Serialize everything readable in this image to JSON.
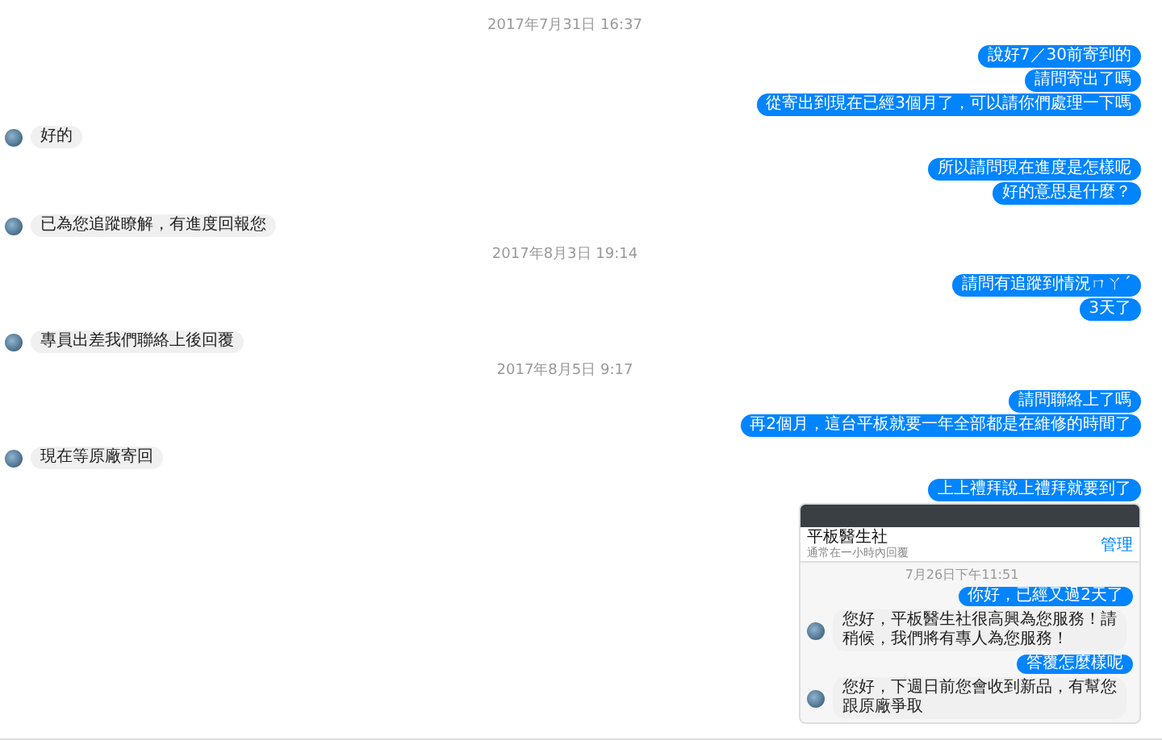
{
  "messages": [
    {
      "kind": "timestamp",
      "text": "2017年7月31日 16:37"
    },
    {
      "kind": "sent",
      "text": "說好7／30前寄到的"
    },
    {
      "kind": "sent",
      "text": "請問寄出了嗎"
    },
    {
      "kind": "sent",
      "text": "從寄出到現在已經3個月了，可以請你們處理一下嗎"
    },
    {
      "kind": "received",
      "text": "好的"
    },
    {
      "kind": "sent",
      "text": "所以請問現在進度是怎樣呢"
    },
    {
      "kind": "sent",
      "text": "好的意思是什麼？"
    },
    {
      "kind": "received",
      "text": "已為您追蹤瞭解，有進度回報您"
    },
    {
      "kind": "timestamp",
      "text": "2017年8月3日 19:14"
    },
    {
      "kind": "sent",
      "text": "請問有追蹤到情況ㄇㄚˊ"
    },
    {
      "kind": "sent",
      "text": "3天了"
    },
    {
      "kind": "received",
      "text": "專員出差我們聯絡上後回覆"
    },
    {
      "kind": "timestamp",
      "text": "2017年8月5日 9:17"
    },
    {
      "kind": "sent",
      "text": "請問聯絡上了嗎"
    },
    {
      "kind": "sent",
      "text": "再2個月，這台平板就要一年全部都是在維修的時間了"
    },
    {
      "kind": "received",
      "text": "現在等原廠寄回"
    },
    {
      "kind": "sent",
      "text": "上上禮拜說上禮拜就要到了"
    }
  ],
  "shared_screenshot": {
    "page_name": "平板醫生社",
    "page_status": "通常在一小時內回覆",
    "manage": "管理",
    "messages": [
      {
        "kind": "timestamp",
        "text": "7月26日下午11:51"
      },
      {
        "kind": "sent",
        "text": "你好，已經又過2天了"
      },
      {
        "kind": "received",
        "text": "您好，平板醫生社很高興為您服務！請稍候，我們將有專人為您服務！"
      },
      {
        "kind": "sent",
        "text": "答覆怎麼樣呢"
      },
      {
        "kind": "received",
        "text": "您好，下週日前您會收到新品，有幫您跟原廠爭取"
      }
    ]
  }
}
